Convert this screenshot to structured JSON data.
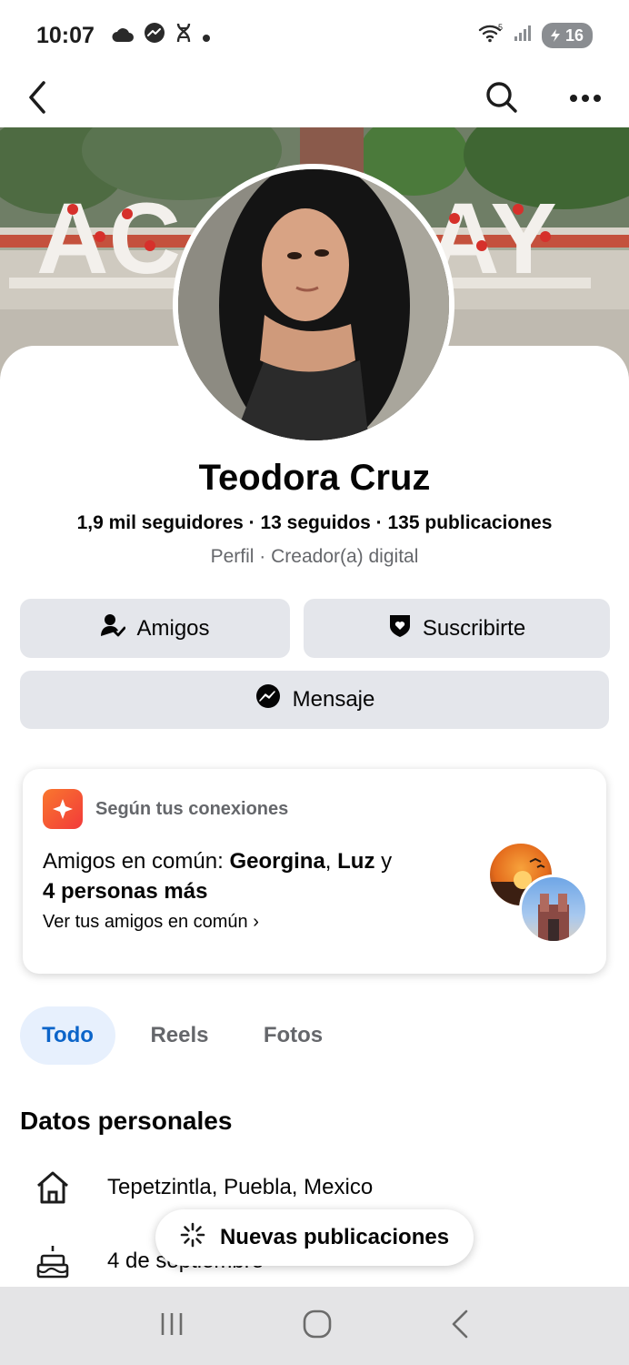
{
  "status_bar": {
    "time": "10:07",
    "battery": "16",
    "icons": [
      "cloud-icon",
      "messenger-icon",
      "dna-icon",
      "dot-icon",
      "wifi-icon",
      "signal-icon",
      "battery-icon"
    ]
  },
  "nav": {
    "back_icon": "chevron-left-icon",
    "search_icon": "search-icon",
    "more_icon": "more-icon"
  },
  "profile": {
    "name": "Teodora Cruz",
    "stats": "1,9 mil seguidores · 13 seguidos · 135 publicaciones",
    "subtitle": "Perfil · Creador(a) digital"
  },
  "actions": {
    "friends_label": "Amigos",
    "subscribe_label": "Suscribirte",
    "message_label": "Mensaje"
  },
  "connections": {
    "heading": "Según tus conexiones",
    "text_prefix": "Amigos en común: ",
    "name1": "Georgina",
    "separator": ", ",
    "name2": "Luz",
    "text_conj": " y",
    "others": "4 personas más",
    "link": "Ver tus amigos en común ›"
  },
  "tabs": [
    {
      "label": "Todo",
      "active": true
    },
    {
      "label": "Reels",
      "active": false
    },
    {
      "label": "Fotos",
      "active": false
    }
  ],
  "personal": {
    "title": "Datos personales",
    "location": "Tepetzintla, Puebla, Mexico",
    "birthday": "4 de septiembre"
  },
  "toast": {
    "label": "Nuevas publicaciones"
  },
  "colors": {
    "accent_blue": "#0b64c9",
    "button_gray": "#e4e6eb",
    "secondary_text": "#65676b"
  }
}
